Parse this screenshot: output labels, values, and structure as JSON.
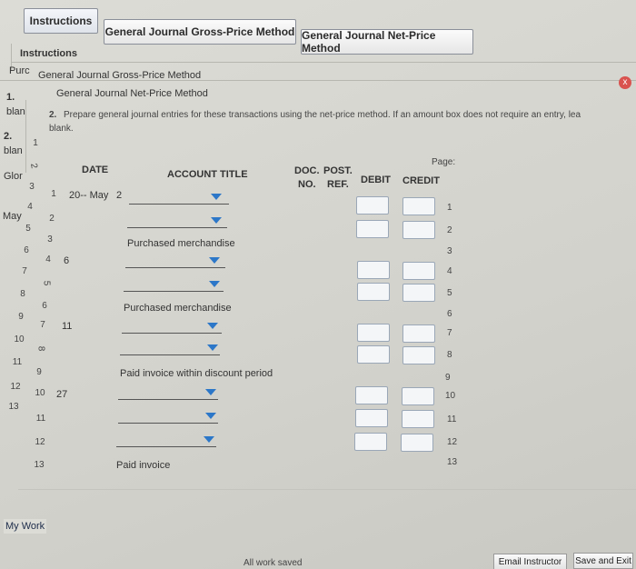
{
  "tabs": [
    "Instructions",
    "General Journal Gross-Price Method",
    "General Journal Net-Price Method"
  ],
  "panel": {
    "title": "Instructions",
    "menu_items": [
      "General Journal Gross-Price Method",
      "General Journal Net-Price Method"
    ],
    "left_fragments": [
      "Purc",
      "1.",
      "blan",
      "2.",
      "blan",
      "Glor",
      "May"
    ],
    "close_label": "x"
  },
  "instructions": {
    "number": "2.",
    "text": "Prepare general journal entries for these transactions using the net-price method. If an amount box does not require an entry, lea",
    "text2": "blank."
  },
  "journal": {
    "page_label": "Page:",
    "headers": {
      "date": "DATE",
      "account": "ACCOUNT TITLE",
      "doc_no_1": "DOC.",
      "doc_no_2": "NO.",
      "post_ref_1": "POST.",
      "post_ref_2": "REF.",
      "debit": "DEBIT",
      "credit": "CREDIT"
    },
    "date_year": "20-- May",
    "rows": [
      {
        "n": "1",
        "day": "2",
        "account": ""
      },
      {
        "n": "2",
        "day": "",
        "account": ""
      },
      {
        "n": "3",
        "day": "",
        "account": "Purchased merchandise"
      },
      {
        "n": "4",
        "day": "6",
        "account": ""
      },
      {
        "n": "5",
        "day": "",
        "account": ""
      },
      {
        "n": "6",
        "day": "",
        "account": "Purchased merchandise"
      },
      {
        "n": "7",
        "day": "11",
        "account": ""
      },
      {
        "n": "8",
        "day": "",
        "account": ""
      },
      {
        "n": "9",
        "day": "",
        "account": "Paid invoice within discount period"
      },
      {
        "n": "10",
        "day": "27",
        "account": ""
      },
      {
        "n": "11",
        "day": "",
        "account": ""
      },
      {
        "n": "12",
        "day": "",
        "account": ""
      },
      {
        "n": "13",
        "day": "",
        "account": "Paid invoice"
      }
    ],
    "behind_numbers": [
      "1",
      "2",
      "3",
      "4",
      "5",
      "6",
      "7",
      "8",
      "9",
      "10",
      "11",
      "12",
      "13"
    ]
  },
  "footer": {
    "my_work": "My Work",
    "status": "All work saved",
    "email": "Email Instructor",
    "save_exit": "Save and Exit"
  }
}
